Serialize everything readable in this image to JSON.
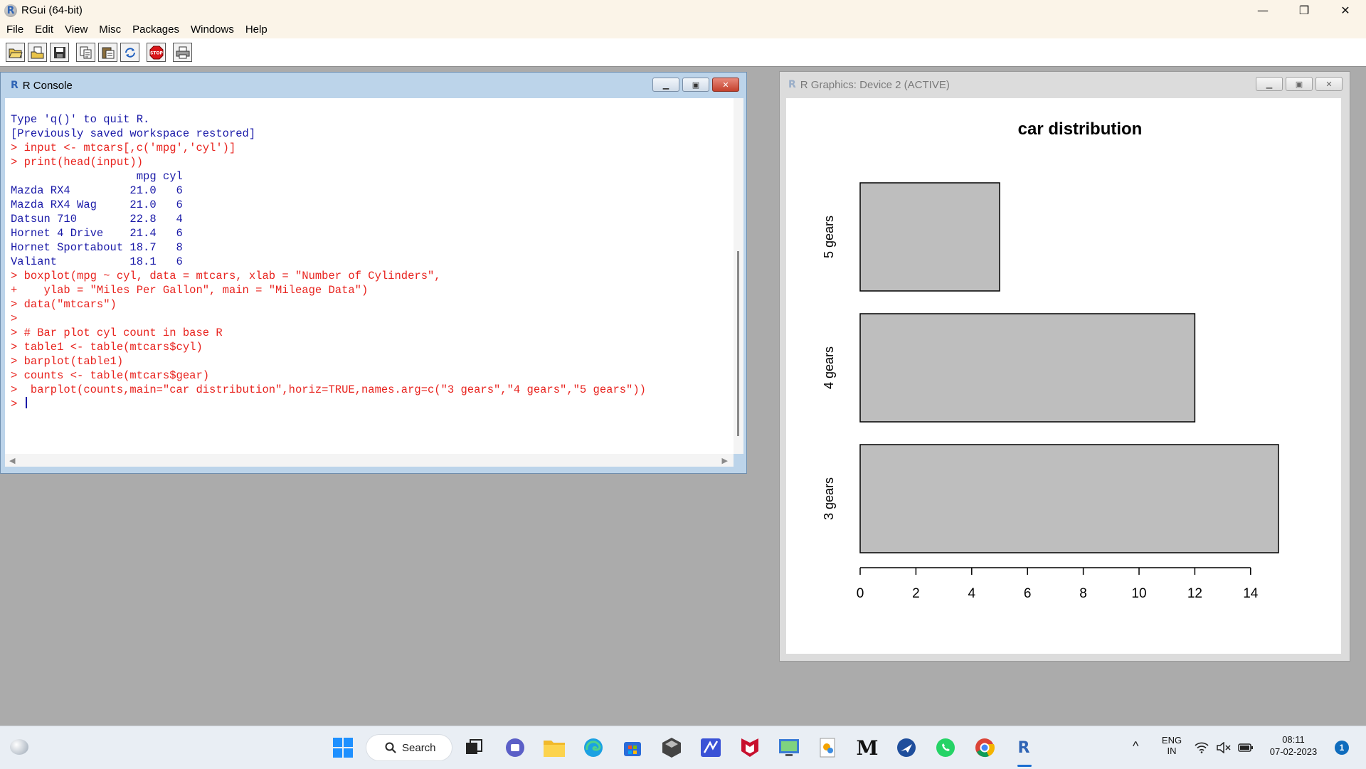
{
  "app": {
    "title": "RGui (64-bit)",
    "icon": "R"
  },
  "window_controls": {
    "minimize": "—",
    "restore": "❐",
    "close": "✕"
  },
  "menu": [
    "File",
    "Edit",
    "View",
    "Misc",
    "Packages",
    "Windows",
    "Help"
  ],
  "toolbar": [
    "open-script-icon",
    "load-workspace-icon",
    "save-icon",
    "copy-icon",
    "paste-icon",
    "copy-paste-icon",
    "stop-icon",
    "print-icon"
  ],
  "console": {
    "title": "R Console",
    "lines": [
      {
        "kind": "out",
        "text": "Type 'q()' to quit R."
      },
      {
        "kind": "out",
        "text": ""
      },
      {
        "kind": "out",
        "text": "[Previously saved workspace restored]"
      },
      {
        "kind": "out",
        "text": ""
      },
      {
        "kind": "in",
        "text": "> input <- mtcars[,c('mpg','cyl')]"
      },
      {
        "kind": "in",
        "text": "> print(head(input))"
      },
      {
        "kind": "out",
        "text": "                   mpg cyl"
      },
      {
        "kind": "out",
        "text": "Mazda RX4         21.0   6"
      },
      {
        "kind": "out",
        "text": "Mazda RX4 Wag     21.0   6"
      },
      {
        "kind": "out",
        "text": "Datsun 710        22.8   4"
      },
      {
        "kind": "out",
        "text": "Hornet 4 Drive    21.4   6"
      },
      {
        "kind": "out",
        "text": "Hornet Sportabout 18.7   8"
      },
      {
        "kind": "out",
        "text": "Valiant           18.1   6"
      },
      {
        "kind": "in",
        "text": "> boxplot(mpg ~ cyl, data = mtcars, xlab = \"Number of Cylinders\","
      },
      {
        "kind": "in",
        "text": "+    ylab = \"Miles Per Gallon\", main = \"Mileage Data\")"
      },
      {
        "kind": "in",
        "text": "> data(\"mtcars\")"
      },
      {
        "kind": "in",
        "text": ">"
      },
      {
        "kind": "in",
        "text": "> # Bar plot cyl count in base R"
      },
      {
        "kind": "in",
        "text": "> table1 <- table(mtcars$cyl)"
      },
      {
        "kind": "in",
        "text": "> barplot(table1)"
      },
      {
        "kind": "in",
        "text": "> counts <- table(mtcars$gear)"
      },
      {
        "kind": "in",
        "text": ">  barplot(counts,main=\"car distribution\",horiz=TRUE,names.arg=c(\"3 gears\",\"4 gears\",\"5 gears\"))"
      }
    ],
    "prompt": "> "
  },
  "graphics": {
    "title": "R Graphics: Device 2 (ACTIVE)"
  },
  "chart_data": {
    "type": "bar",
    "orientation": "horizontal",
    "title": "car distribution",
    "categories": [
      "3 gears",
      "4 gears",
      "5 gears"
    ],
    "values": [
      15,
      12,
      5
    ],
    "xticks": [
      0,
      2,
      4,
      6,
      8,
      10,
      12,
      14
    ],
    "xlim": [
      0,
      15
    ],
    "bar_color": "#bebebe",
    "grid": false
  },
  "taskbar": {
    "search_label": "Search",
    "icons": [
      "start-icon",
      "task-view-icon",
      "teams-icon",
      "file-explorer-icon",
      "edge-icon",
      "store-icon",
      "app-icon",
      "pen-app-icon",
      "mcafee-icon",
      "screen-app-icon",
      "paint-app-icon",
      "m-app-icon",
      "browser-app-icon",
      "whatsapp-icon",
      "chrome-icon",
      "r-icon"
    ],
    "tray": {
      "lang_top": "ENG",
      "lang_bottom": "IN",
      "time": "08:11",
      "date": "07-02-2023",
      "notification_count": "1",
      "chevron": "^"
    }
  }
}
